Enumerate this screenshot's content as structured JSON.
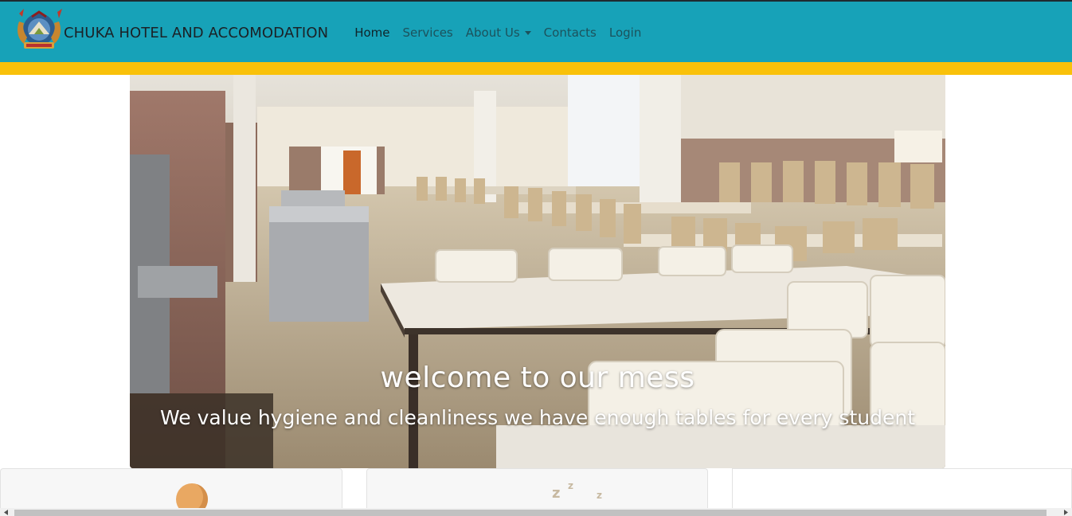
{
  "navbar": {
    "brand_text": "CHUKA HOTEL AND ACCOMODATION",
    "logo_icon": "chuka-university-crest",
    "links": [
      {
        "label": "Home",
        "active": true
      },
      {
        "label": "Services",
        "active": false
      },
      {
        "label": "About Us",
        "active": false,
        "dropdown": true
      },
      {
        "label": "Contacts",
        "active": false
      },
      {
        "label": "Login",
        "active": false
      }
    ],
    "bg_color": "#17a2b8"
  },
  "stripe_color": "#f9c10a",
  "hero": {
    "title": "welcome to our mess",
    "subtitle": "We value hygiene and cleanliness we have enough tables for every student",
    "image_subject": "dining-hall-photo"
  },
  "cards": [
    {
      "icon": "sun-icon"
    },
    {
      "icon": "sleep-zzz-icon",
      "glyphs": [
        "z",
        "z",
        "z"
      ]
    },
    {
      "icon": ""
    }
  ]
}
